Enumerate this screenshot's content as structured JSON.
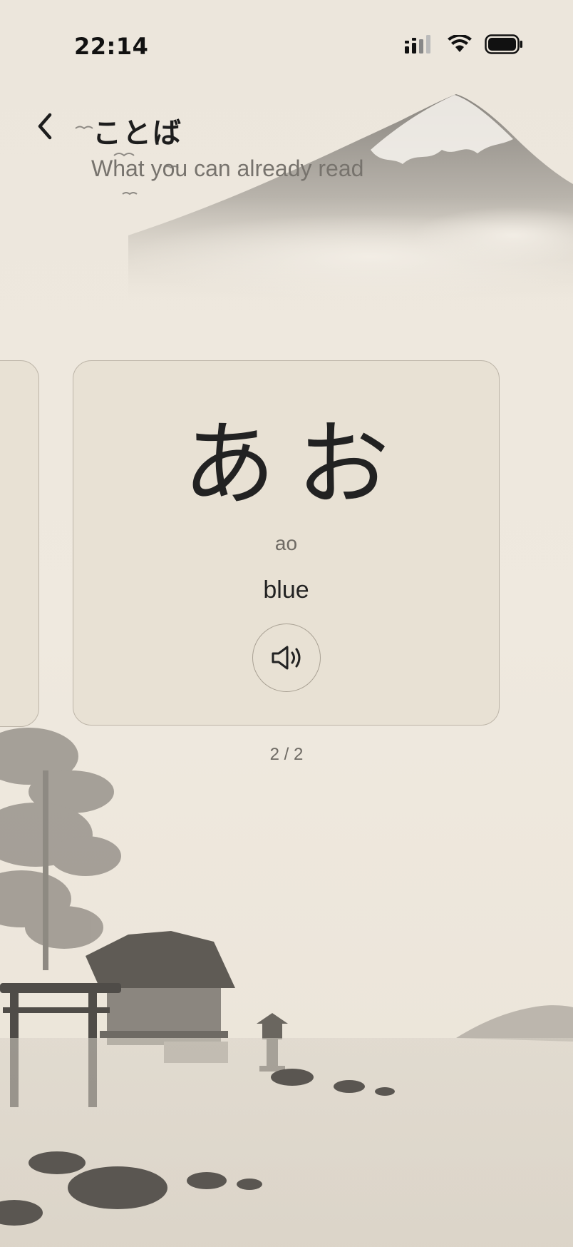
{
  "status_bar": {
    "time": "22:14",
    "icons": [
      "signal-icon",
      "wifi-icon",
      "battery-icon"
    ]
  },
  "header": {
    "back_icon": "chevron-left-icon",
    "title": "ことば",
    "subtitle": "What you can already read"
  },
  "card": {
    "kana": "あお",
    "romaji": "ao",
    "meaning": "blue",
    "audio_icon": "speaker-icon"
  },
  "pager": {
    "text": "2 / 2",
    "current": 2,
    "total": 2
  },
  "colors": {
    "background": "#efe8dc",
    "card": "#e8e1d4",
    "card_border": "#bdb5a8",
    "text": "#222222",
    "muted_text": "#77736d"
  }
}
